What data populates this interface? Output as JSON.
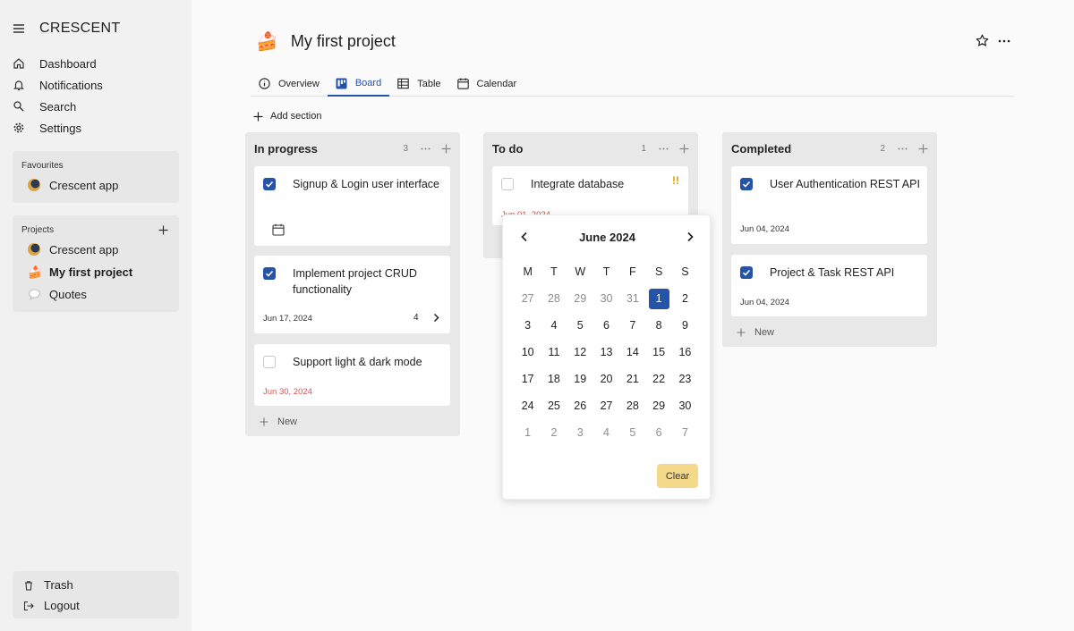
{
  "sidebar": {
    "brand": "CRESCENT",
    "nav": [
      {
        "label": "Dashboard",
        "icon": "home-icon"
      },
      {
        "label": "Notifications",
        "icon": "bell-icon"
      },
      {
        "label": "Search",
        "icon": "search-icon"
      },
      {
        "label": "Settings",
        "icon": "gear-icon"
      }
    ],
    "favourites": {
      "title": "Favourites",
      "items": [
        {
          "label": "Crescent app",
          "icon": "moon-icon"
        }
      ]
    },
    "projects": {
      "title": "Projects",
      "items": [
        {
          "label": "Crescent app",
          "icon": "moon-icon"
        },
        {
          "label": "My first project",
          "icon": "cake-icon"
        },
        {
          "label": "Quotes",
          "icon": "speech-bubble-icon"
        }
      ]
    },
    "bottom": [
      {
        "label": "Trash",
        "icon": "trash-icon"
      },
      {
        "label": "Logout",
        "icon": "logout-icon"
      }
    ]
  },
  "header": {
    "title": "My first project",
    "emoji": "🍰"
  },
  "tabs": [
    {
      "label": "Overview",
      "icon": "info-icon"
    },
    {
      "label": "Board",
      "icon": "board-icon"
    },
    {
      "label": "Table",
      "icon": "table-icon"
    },
    {
      "label": "Calendar",
      "icon": "calendar-icon"
    }
  ],
  "active_tab": "Board",
  "add_section_label": "Add section",
  "columns": [
    {
      "title": "In progress",
      "count": "3",
      "new_label": "New",
      "cards": [
        {
          "text": "Signup & Login user interface",
          "checked": true,
          "date": ""
        },
        {
          "text": "Implement project CRUD functionality",
          "checked": true,
          "date": "Jun 17, 2024",
          "subtasks": "4"
        },
        {
          "text": "Support light & dark mode",
          "checked": false,
          "date": "Jun 30, 2024"
        }
      ]
    },
    {
      "title": "To do",
      "count": "1",
      "cards": [
        {
          "text": "Integrate database",
          "checked": false,
          "priority": "!!",
          "date": "Jun 01, 2024"
        }
      ]
    },
    {
      "title": "Completed",
      "count": "2",
      "new_label": "New",
      "cards": [
        {
          "text": "User Authentication REST API",
          "checked": true,
          "date": "Jun 04, 2024"
        },
        {
          "text": "Project & Task REST API",
          "checked": true,
          "date": "Jun 04, 2024"
        }
      ]
    }
  ],
  "calendar": {
    "month_label": "June 2024",
    "weekdays": [
      "M",
      "T",
      "W",
      "T",
      "F",
      "S",
      "S"
    ],
    "weeks": [
      [
        "27",
        "28",
        "29",
        "30",
        "31",
        "1",
        "2"
      ],
      [
        "3",
        "4",
        "5",
        "6",
        "7",
        "8",
        "9"
      ],
      [
        "10",
        "11",
        "12",
        "13",
        "14",
        "15",
        "16"
      ],
      [
        "17",
        "18",
        "19",
        "20",
        "21",
        "22",
        "23"
      ],
      [
        "24",
        "25",
        "26",
        "27",
        "28",
        "29",
        "30"
      ],
      [
        "1",
        "2",
        "3",
        "4",
        "5",
        "6",
        "7"
      ]
    ],
    "selected": "1",
    "clear_label": "Clear"
  },
  "colors": {
    "accent": "#2453a8",
    "clear": "#f5d98a",
    "overdue": "#d9534f",
    "priority": "#e0a100"
  }
}
